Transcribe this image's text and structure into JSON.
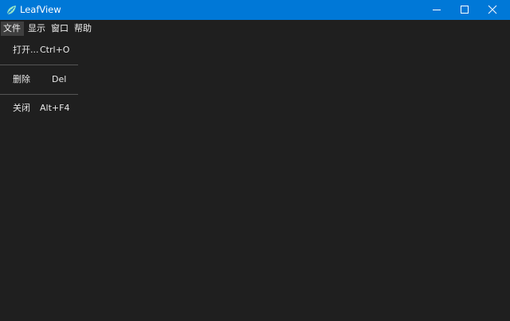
{
  "window": {
    "title": "LeafView",
    "accent_color": "#0078d7",
    "background_color": "#1f1f1f",
    "icon": "leaf-icon",
    "controls": {
      "minimize_icon": "minimize-icon",
      "maximize_icon": "maximize-icon",
      "close_icon": "close-icon"
    }
  },
  "menubar": {
    "items": [
      {
        "label": "文件",
        "active": true
      },
      {
        "label": "显示",
        "active": false
      },
      {
        "label": "窗口",
        "active": false
      },
      {
        "label": "帮助",
        "active": false
      }
    ]
  },
  "file_menu": {
    "items": [
      {
        "label": "打开...",
        "shortcut": "Ctrl+O"
      },
      {
        "label": "删除",
        "shortcut": "Del"
      },
      {
        "label": "关闭",
        "shortcut": "Alt+F4"
      }
    ]
  }
}
